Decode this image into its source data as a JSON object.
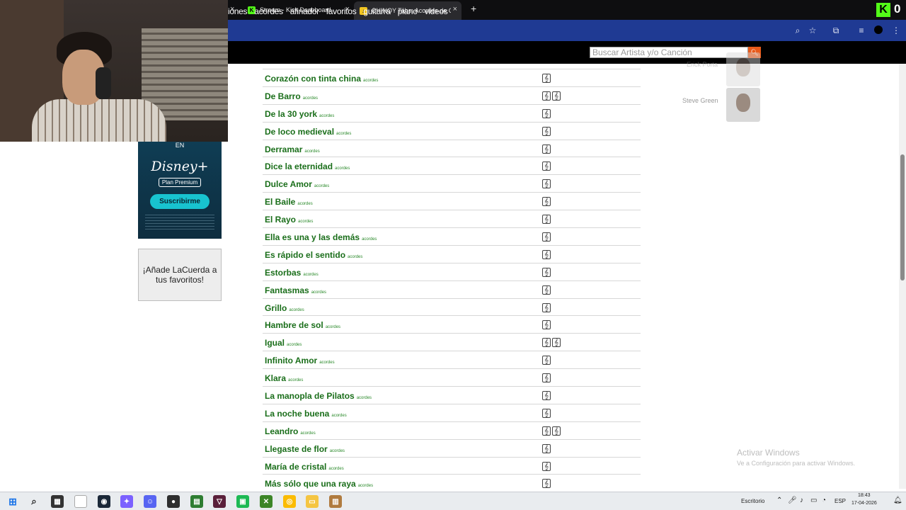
{
  "browser": {
    "tabs": [
      {
        "label": "Stream - Kick Dashboard",
        "active": false
      },
      {
        "label": "CHINOY Tabs: Acordes de Guita",
        "active": true
      }
    ],
    "new_tab_symbol": "+",
    "close_symbol": "×",
    "kick_logo": "K",
    "kick_count": "0"
  },
  "site": {
    "nav": [
      "iones",
      "acordes",
      "afinador",
      "favoritos",
      "guitarra",
      "piano",
      "videos"
    ],
    "search_placeholder": "Buscar Artista y/o Canción"
  },
  "ad": {
    "top": "EN",
    "logo": "Disney+",
    "plan": "Plan Premium",
    "button": "Suscribirme"
  },
  "favorites_box": "¡Añade LaCuerda a tus favoritos!",
  "songs": [
    {
      "title": "Corazón con tinta china",
      "type": "acordes",
      "icons": 1
    },
    {
      "title": "De Barro",
      "type": "acordes",
      "icons": 2
    },
    {
      "title": "De la 30 york",
      "type": "acordes",
      "icons": 1
    },
    {
      "title": "De loco medieval",
      "type": "acordes",
      "icons": 1
    },
    {
      "title": "Derramar",
      "type": "acordes",
      "icons": 1
    },
    {
      "title": "Dice la eternidad",
      "type": "acordes",
      "icons": 1
    },
    {
      "title": "Dulce Amor",
      "type": "acordes",
      "icons": 1
    },
    {
      "title": "El Baile",
      "type": "acordes",
      "icons": 1
    },
    {
      "title": "El Rayo",
      "type": "acordes",
      "icons": 1
    },
    {
      "title": "Ella es una y las demás",
      "type": "acordes",
      "icons": 1
    },
    {
      "title": "Es rápido el sentido",
      "type": "acordes",
      "icons": 1
    },
    {
      "title": "Estorbas",
      "type": "acordes",
      "icons": 1
    },
    {
      "title": "Fantasmas",
      "type": "acordes",
      "icons": 1
    },
    {
      "title": "Grillo",
      "type": "acordes",
      "icons": 1
    },
    {
      "title": "Hambre de sol",
      "type": "acordes",
      "icons": 1
    },
    {
      "title": "Igual",
      "type": "acordes",
      "icons": 2
    },
    {
      "title": "Infinito Amor",
      "type": "acordes",
      "icons": 1
    },
    {
      "title": "Klara",
      "type": "acordes",
      "icons": 1
    },
    {
      "title": "La manopla de Pilatos",
      "type": "acordes",
      "icons": 1
    },
    {
      "title": "La noche buena",
      "type": "acordes",
      "icons": 1
    },
    {
      "title": "Leandro",
      "type": "acordes",
      "icons": 2
    },
    {
      "title": "Llegaste de flor",
      "type": "acordes",
      "icons": 1
    },
    {
      "title": "María de cristal",
      "type": "acordes",
      "icons": 1
    },
    {
      "title": "Más sólo que una raya",
      "type": "acordes",
      "icons": 1
    }
  ],
  "clef_symbol": "𝄞",
  "sidebar_artists": [
    {
      "name": "Erick Porta"
    },
    {
      "name": "Steve Green"
    }
  ],
  "watermark": {
    "title": "Activar Windows",
    "subtitle": "Ve a Configuración para activar Windows."
  },
  "taskbar": {
    "desktop_label": "Escritorio",
    "lang": "ESP",
    "time": "18:43",
    "date": "17-04-2026"
  },
  "colors": {
    "song_link": "#1a6e1a",
    "nav_bg": "#000000",
    "address_bar": "#1f3a93",
    "kick_green": "#53fc18",
    "search_button": "#e85a1a"
  }
}
